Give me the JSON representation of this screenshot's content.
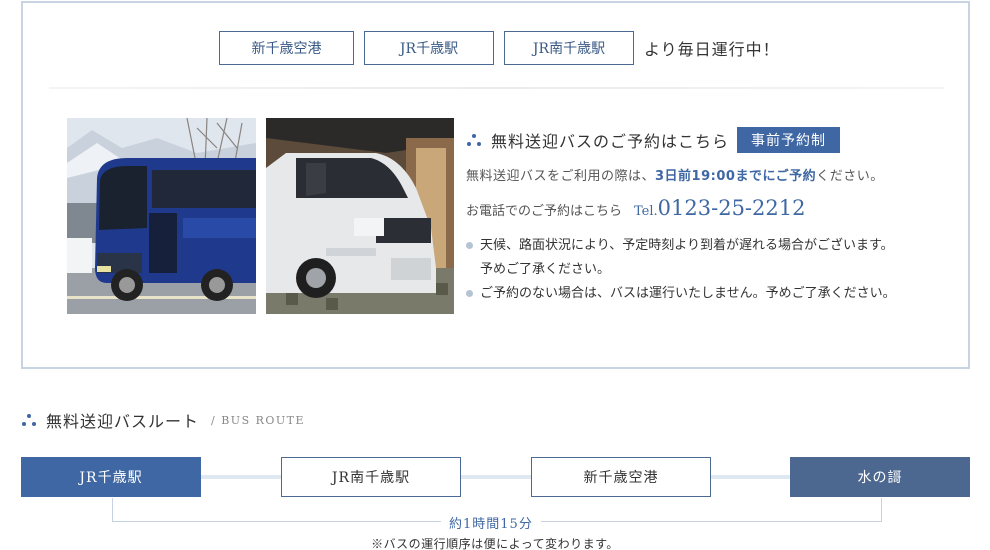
{
  "stations": {
    "items": [
      "新千歳空港",
      "JR千歳駅",
      "JR南千歳駅"
    ],
    "suffix": "より毎日運行中！"
  },
  "reservation": {
    "title": "無料送迎バスのご予約はこちら",
    "badge": "事前予約制",
    "line1_prefix": "無料送迎バスをご利用の際は、",
    "line1_strong": "3日前19:00までにご予約",
    "line1_suffix": "ください。",
    "phone_label": "お電話でのご予約はこちら",
    "phone_prefix": "Tel.",
    "phone_number": "0123-25-2212",
    "notes": [
      "天候、路面状況により、予定時刻より到着が遅れる場合がございます。",
      "予めご了承ください。",
      "ご予約のない場合は、バスは運行いたしません。予めご了承ください。"
    ]
  },
  "route": {
    "title": "無料送迎バスルート",
    "subtitle": "/ BUS ROUTE",
    "stops": [
      "JR千歳駅",
      "JR南千歳駅",
      "新千歳空港",
      "水の謌"
    ],
    "duration": "約1時間15分",
    "note": "※バスの運行順序は便によって変わります。"
  },
  "colors": {
    "accent": "#3e67a3",
    "panel_border": "#c8d3e3",
    "end_stop": "#4d6890"
  },
  "icons": {
    "dots": "triple-dot-icon",
    "bullet": "bullet-dot-icon"
  }
}
